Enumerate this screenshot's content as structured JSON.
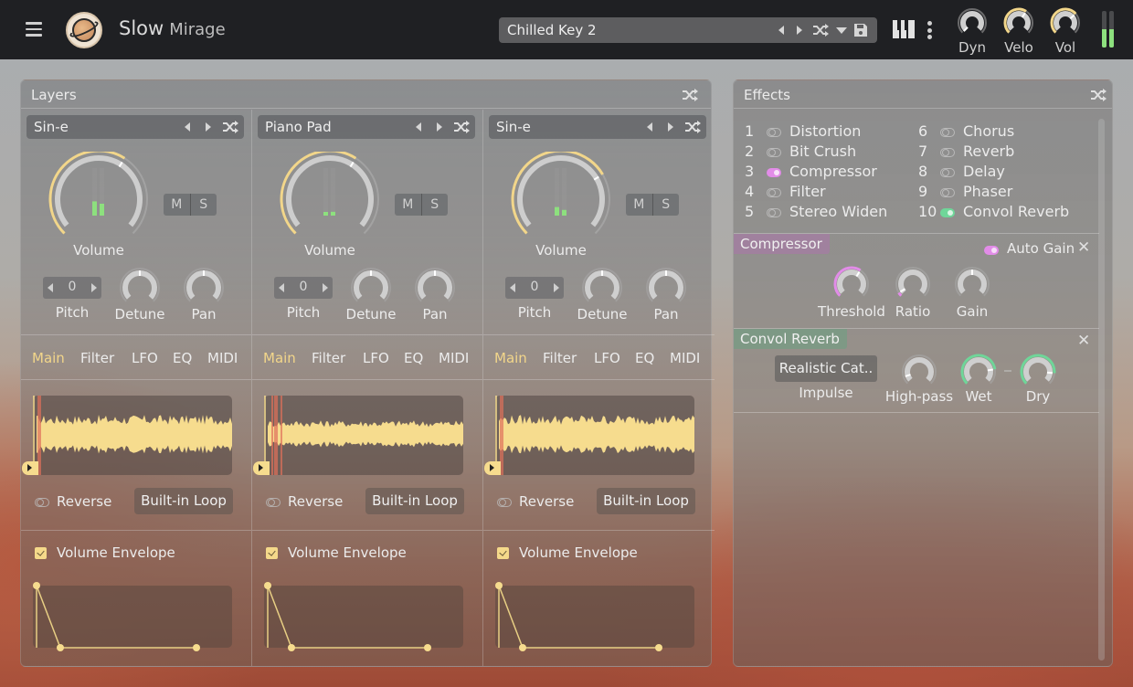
{
  "app": {
    "title": "Slow",
    "subtitle": "Mirage"
  },
  "header": {
    "preset_name": "Chilled Key 2",
    "knobs": [
      {
        "label": "Dyn",
        "value": 0.0
      },
      {
        "label": "Velo",
        "value": 0.62
      },
      {
        "label": "Vol",
        "value": 0.68
      }
    ],
    "meter_levels": [
      0.5,
      0.5
    ]
  },
  "layers": {
    "title": "Layers",
    "tabs": [
      "Main",
      "Filter",
      "LFO",
      "EQ",
      "MIDI"
    ],
    "active_tab": "Main",
    "volume_label": "Volume",
    "pitch_label": "Pitch",
    "detune_label": "Detune",
    "pan_label": "Pan",
    "mute_label": "M",
    "solo_label": "S",
    "reverse_label": "Reverse",
    "loop_label": "Built-in Loop",
    "envelope_label": "Volume Envelope",
    "items": [
      {
        "name": "Sin-e",
        "volume": 0.62,
        "meter": [
          0.3,
          0.25
        ],
        "pitch": "0",
        "detune": 0.5,
        "pan": 0.5,
        "reverse": false,
        "envelope_enabled": true
      },
      {
        "name": "Piano Pad",
        "volume": 0.62,
        "meter": [
          0.0,
          0.08
        ],
        "pitch": "0",
        "detune": 0.5,
        "pan": 0.5,
        "reverse": false,
        "envelope_enabled": true
      },
      {
        "name": "Sin-e",
        "volume": 0.72,
        "meter": [
          0.18,
          0.12
        ],
        "pitch": "0",
        "detune": 0.5,
        "pan": 0.5,
        "reverse": false,
        "envelope_enabled": true
      }
    ]
  },
  "effects": {
    "title": "Effects",
    "list": [
      {
        "num": "1",
        "name": "Distortion",
        "on": false,
        "color": ""
      },
      {
        "num": "2",
        "name": "Bit Crush",
        "on": false,
        "color": ""
      },
      {
        "num": "3",
        "name": "Compressor",
        "on": true,
        "color": "#e28ce8"
      },
      {
        "num": "4",
        "name": "Filter",
        "on": false,
        "color": ""
      },
      {
        "num": "5",
        "name": "Stereo Widen",
        "on": false,
        "color": ""
      },
      {
        "num": "6",
        "name": "Chorus",
        "on": false,
        "color": ""
      },
      {
        "num": "7",
        "name": "Reverb",
        "on": false,
        "color": ""
      },
      {
        "num": "8",
        "name": "Delay",
        "on": false,
        "color": ""
      },
      {
        "num": "9",
        "name": "Phaser",
        "on": false,
        "color": ""
      },
      {
        "num": "10",
        "name": "Convol Reverb",
        "on": true,
        "color": "#6fd699"
      }
    ],
    "compressor": {
      "title": "Compressor",
      "auto_gain_label": "Auto Gain",
      "auto_gain": true,
      "knobs": [
        {
          "label": "Threshold",
          "value": 0.62
        },
        {
          "label": "Ratio",
          "value": 0.05
        },
        {
          "label": "Gain",
          "value": 0.5
        }
      ]
    },
    "convol_reverb": {
      "title": "Convol Reverb",
      "impulse_value": "Realistic Cat..",
      "impulse_label": "Impulse",
      "knobs": [
        {
          "label": "High-pass",
          "value": 0.1
        },
        {
          "label": "Wet",
          "value": 0.8
        },
        {
          "label": "Dry",
          "value": 0.85
        }
      ]
    }
  },
  "colors": {
    "accent": "#f2d68a",
    "compressor": "#e28ce8",
    "reverb": "#6fd699",
    "meter": "#8de07e"
  }
}
